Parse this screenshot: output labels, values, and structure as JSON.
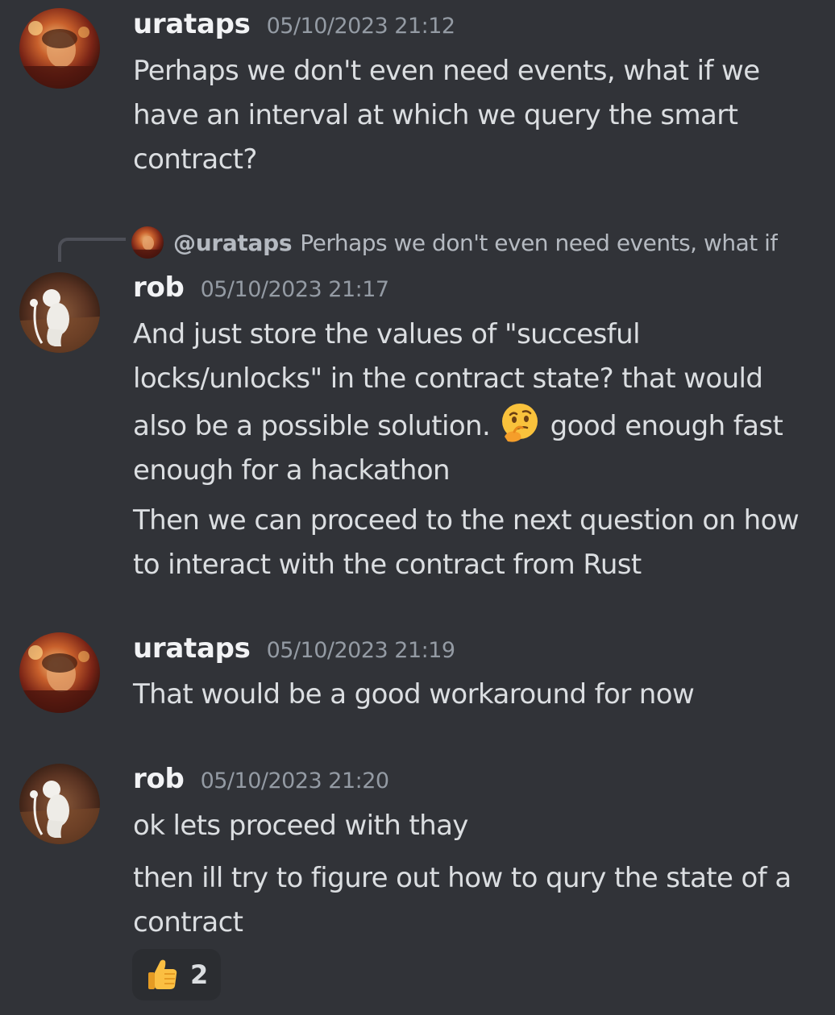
{
  "messages": [
    {
      "author": "urataps",
      "timestamp": "05/10/2023 21:12",
      "lines": [
        "Perhaps we don't even need events, what if we have an interval at which we query the smart contract?"
      ]
    },
    {
      "author": "rob",
      "timestamp": "05/10/2023 21:17",
      "reply": {
        "author": "@urataps",
        "text": "Perhaps we don't even need events, what if"
      },
      "text_before_emoji": "And just store the values of \"succesful locks/unlocks\" in the contract state? that would also be a possible solution. ",
      "emoji": "thinking-face",
      "text_after_emoji": " good enough fast enough for a hackathon",
      "second": "Then we can proceed to the next question on how to interact with the contract from Rust"
    },
    {
      "author": "urataps",
      "timestamp": "05/10/2023 21:19",
      "text": "That would be a good workaround for now"
    },
    {
      "author": "rob",
      "timestamp": "05/10/2023 21:20",
      "text": "ok lets proceed with thay",
      "second": "then ill try to figure out how to qury the state of a contract",
      "reaction": {
        "emoji": "thumbs-up",
        "count": "2"
      }
    }
  ]
}
